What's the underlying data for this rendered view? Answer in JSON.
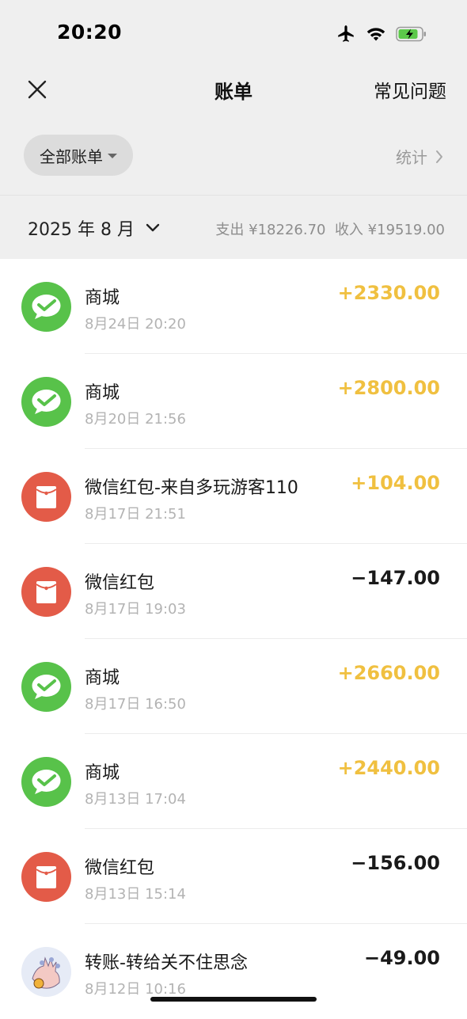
{
  "status_bar": {
    "time": "20:20",
    "icons": [
      "airplane-icon",
      "wifi-icon",
      "battery-charging-icon"
    ]
  },
  "nav": {
    "close_icon": "close-icon",
    "title": "账单",
    "faq_label": "常见问题"
  },
  "filter": {
    "label": "全部账单",
    "stats_label": "统计"
  },
  "month": {
    "label": "2025 年 8 月",
    "expense_label": "支出 ¥18226.70",
    "income_label": "收入 ¥19519.00"
  },
  "transactions": [
    {
      "icon": "wechat-pay-icon",
      "title": "商城",
      "time": "8月24日 20:20",
      "amount": "+2330.00",
      "type": "income"
    },
    {
      "icon": "wechat-pay-icon",
      "title": "商城",
      "time": "8月20日 21:56",
      "amount": "+2800.00",
      "type": "income"
    },
    {
      "icon": "red-packet-icon",
      "title": "微信红包-来自多玩游客110",
      "time": "8月17日 21:51",
      "amount": "+104.00",
      "type": "income"
    },
    {
      "icon": "red-packet-icon",
      "title": "微信红包",
      "time": "8月17日 19:03",
      "amount": "−147.00",
      "type": "expense"
    },
    {
      "icon": "wechat-pay-icon",
      "title": "商城",
      "time": "8月17日 16:50",
      "amount": "+2660.00",
      "type": "income"
    },
    {
      "icon": "wechat-pay-icon",
      "title": "商城",
      "time": "8月13日 17:04",
      "amount": "+2440.00",
      "type": "income"
    },
    {
      "icon": "red-packet-icon",
      "title": "微信红包",
      "time": "8月13日 15:14",
      "amount": "−156.00",
      "type": "expense"
    },
    {
      "icon": "avatar-icon",
      "title": "转账-转给关不住思念",
      "time": "8月12日 10:16",
      "amount": "−49.00",
      "type": "expense"
    }
  ],
  "colors": {
    "income": "#f0c040",
    "expense": "#1a1a1a",
    "wechat_green": "#58c24a",
    "red_packet": "#e35b48",
    "header_bg": "#efefef"
  }
}
